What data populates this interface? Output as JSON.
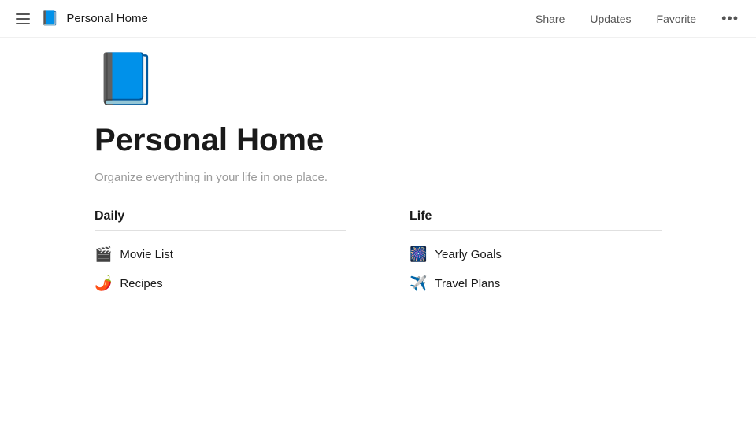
{
  "topbar": {
    "title": "Personal Home",
    "actions": [
      {
        "id": "share",
        "label": "Share"
      },
      {
        "id": "updates",
        "label": "Updates"
      },
      {
        "id": "favorite",
        "label": "Favorite"
      }
    ],
    "more_label": "•••"
  },
  "page": {
    "cover_emoji": "📘",
    "title": "Personal Home",
    "description": "Organize everything in your life in one place."
  },
  "sections": [
    {
      "id": "daily",
      "title": "Daily",
      "items": [
        {
          "id": "movie-list",
          "emoji": "🎬",
          "label": "Movie List"
        },
        {
          "id": "recipes",
          "emoji": "🌶️",
          "label": "Recipes"
        }
      ]
    },
    {
      "id": "life",
      "title": "Life",
      "items": [
        {
          "id": "yearly-goals",
          "emoji": "🎆",
          "label": "Yearly Goals"
        },
        {
          "id": "travel-plans",
          "emoji": "✈️",
          "label": "Travel Plans"
        }
      ]
    }
  ]
}
